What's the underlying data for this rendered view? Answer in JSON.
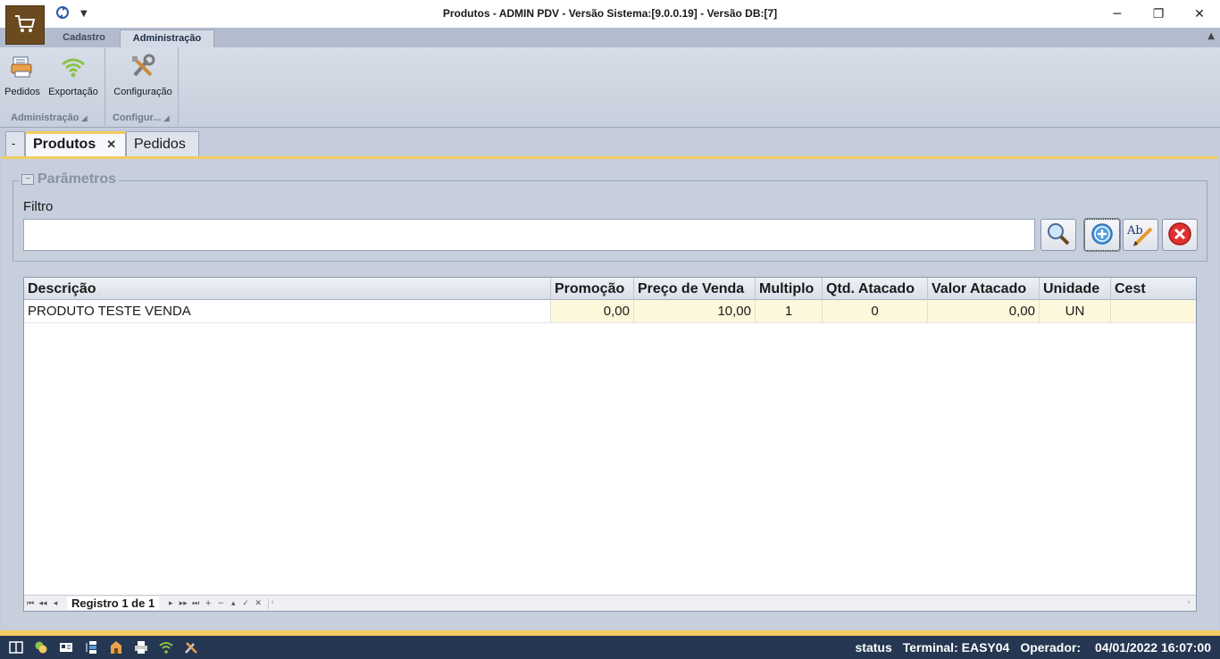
{
  "window": {
    "title": "Produtos - ADMIN PDV - Versão Sistema:[9.0.0.19] - Versão DB:[7]"
  },
  "ribbon": {
    "tabs": [
      {
        "label": "Cadastro"
      },
      {
        "label": "Administração"
      }
    ],
    "groups": [
      {
        "label": "Administração",
        "buttons": [
          {
            "label": "Pedidos"
          },
          {
            "label": "Exportação"
          }
        ]
      },
      {
        "label": "Configur...",
        "buttons": [
          {
            "label": "Configuração"
          }
        ]
      }
    ]
  },
  "doc_tabs": [
    {
      "label": "-"
    },
    {
      "label": "Produtos"
    },
    {
      "label": "Pedidos"
    }
  ],
  "params": {
    "title": "Parâmetros",
    "filter_label": "Filtro",
    "filter_value": ""
  },
  "grid": {
    "columns": [
      "Descrição",
      "Promoção",
      "Preço de Venda",
      "Multiplo",
      "Qtd. Atacado",
      "Valor Atacado",
      "Unidade",
      "Cest"
    ],
    "rows": [
      [
        "PRODUTO TESTE VENDA",
        "0,00",
        "10,00",
        "1",
        "0",
        "0,00",
        "UN",
        ""
      ]
    ],
    "record_info": "Registro 1 de 1"
  },
  "status": {
    "status": "status",
    "terminal": "Terminal: EASY04",
    "operator": "Operador:",
    "datetime": "04/01/2022 16:07:00"
  },
  "colors": {
    "accent": "#f2cc60",
    "statusbar": "#253752",
    "app_button": "#6b4a1f"
  }
}
